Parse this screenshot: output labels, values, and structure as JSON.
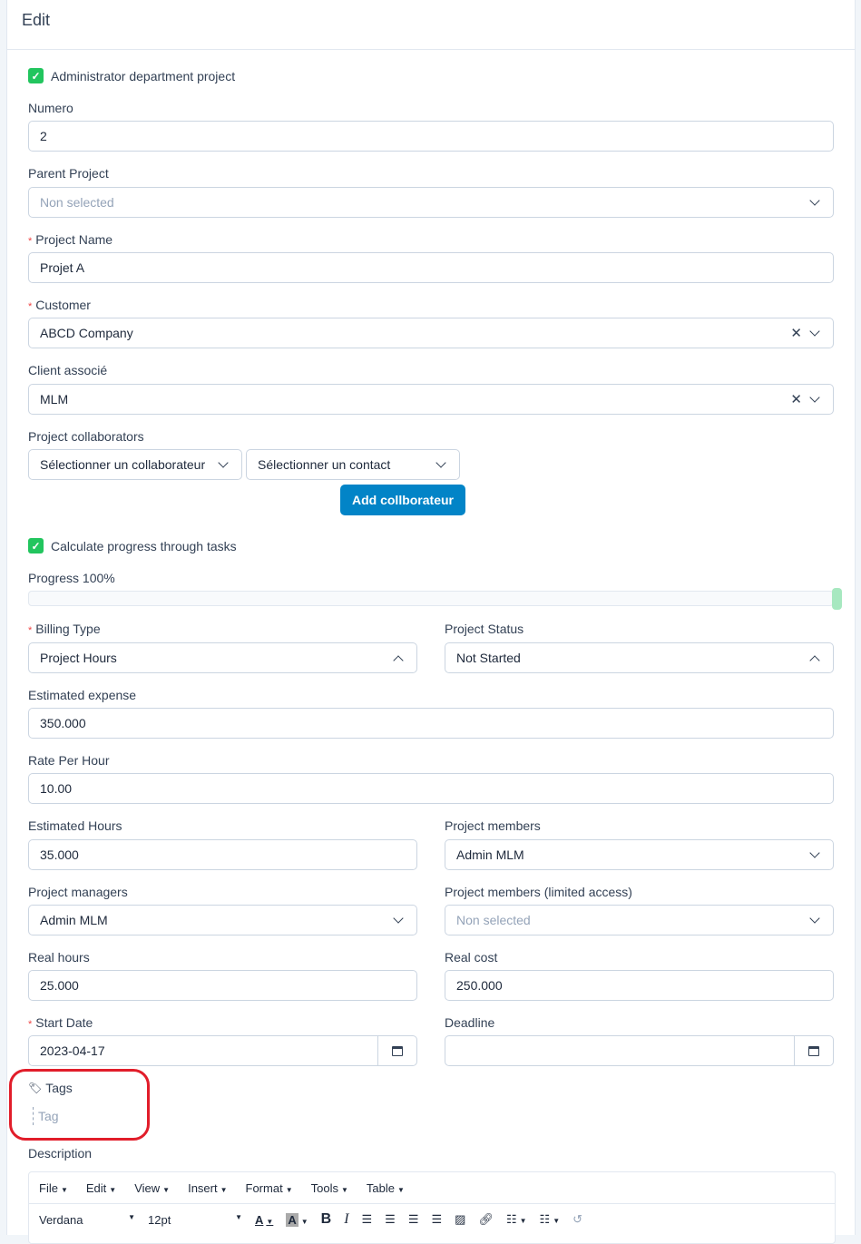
{
  "header": {
    "title": "Edit"
  },
  "admin_checkbox": {
    "label": "Administrator department project",
    "checked": true
  },
  "numero": {
    "label": "Numero",
    "value": "2"
  },
  "parent_project": {
    "label": "Parent Project",
    "placeholder": "Non selected"
  },
  "project_name": {
    "label": "Project Name",
    "value": "Projet A",
    "required": true
  },
  "customer": {
    "label": "Customer",
    "value": "ABCD Company",
    "required": true
  },
  "client_associe": {
    "label": "Client associé",
    "value": "MLM"
  },
  "collaborators": {
    "label": "Project collaborators",
    "collaborator_select": "Sélectionner un collaborateur",
    "contact_select": "Sélectionner un contact",
    "add_button": "Add collborateur"
  },
  "progress_checkbox": {
    "label": "Calculate progress through tasks",
    "checked": true
  },
  "progress": {
    "label": "Progress 100%",
    "value": 100
  },
  "billing_type": {
    "label": "Billing Type",
    "value": "Project Hours",
    "required": true
  },
  "project_status": {
    "label": "Project Status",
    "value": "Not Started"
  },
  "estimated_expense": {
    "label": "Estimated expense",
    "value": "350.000"
  },
  "rate_per_hour": {
    "label": "Rate Per Hour",
    "value": "10.00"
  },
  "estimated_hours": {
    "label": "Estimated Hours",
    "value": "35.000"
  },
  "project_members": {
    "label": "Project members",
    "value": "Admin MLM"
  },
  "project_managers": {
    "label": "Project managers",
    "value": "Admin MLM"
  },
  "members_limited": {
    "label": "Project members (limited access)",
    "placeholder": "Non selected"
  },
  "real_hours": {
    "label": "Real hours",
    "value": "25.000"
  },
  "real_cost": {
    "label": "Real cost",
    "value": "250.000"
  },
  "start_date": {
    "label": "Start Date",
    "value": "2023-04-17",
    "required": true
  },
  "deadline": {
    "label": "Deadline",
    "value": ""
  },
  "tags": {
    "label": "Tags",
    "placeholder": "Tag"
  },
  "description": {
    "label": "Description"
  },
  "editor": {
    "menus": [
      "File",
      "Edit",
      "View",
      "Insert",
      "Format",
      "Tools",
      "Table"
    ],
    "font": "Verdana",
    "size": "12pt"
  },
  "colors": {
    "accent": "#0284c7",
    "success": "#22c55e",
    "highlight": "#e11d2a"
  }
}
